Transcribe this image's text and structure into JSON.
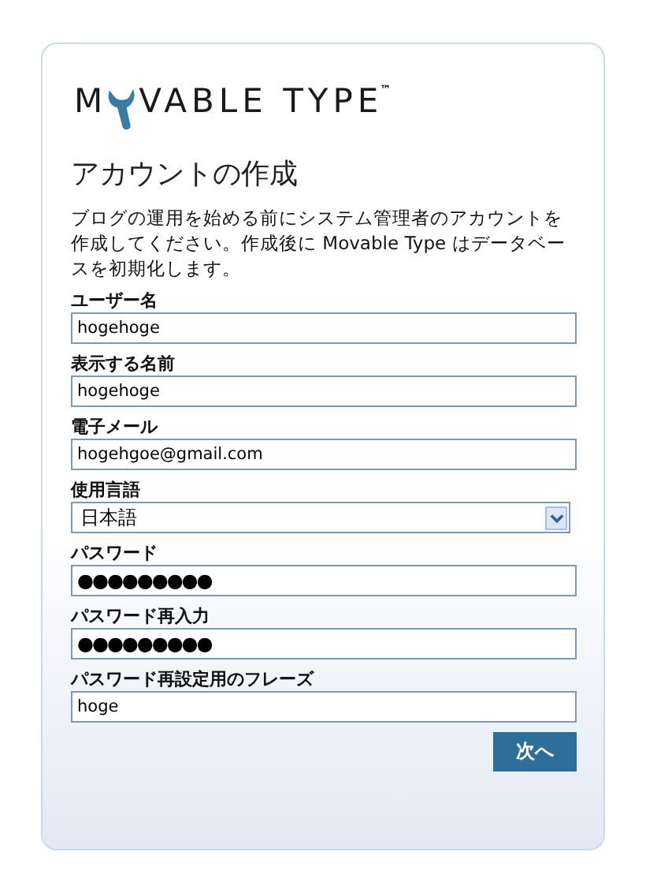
{
  "logo": {
    "before": "M",
    "after": "VABLE TYPE",
    "mark": "™"
  },
  "title": "アカウントの作成",
  "intro": "ブログの運用を始める前にシステム管理者のアカウントを作成してください。作成後に Movable Type はデータベースを初期化します。",
  "fields": [
    {
      "kind": "text",
      "label": "ユーザー名",
      "value": "hogehoge"
    },
    {
      "kind": "text",
      "label": "表示する名前",
      "value": "hogehoge"
    },
    {
      "kind": "text",
      "label": "電子メール",
      "value": "hogehgoe@gmail.com"
    },
    {
      "kind": "select",
      "label": "使用言語",
      "value": "日本語"
    },
    {
      "kind": "password",
      "label": "パスワード",
      "value": "●●●●●●●●●"
    },
    {
      "kind": "password",
      "label": "パスワード再入力",
      "value": "●●●●●●●●●"
    },
    {
      "kind": "text",
      "label": "パスワード再設定用のフレーズ",
      "value": "hoge"
    }
  ],
  "button": "次へ"
}
